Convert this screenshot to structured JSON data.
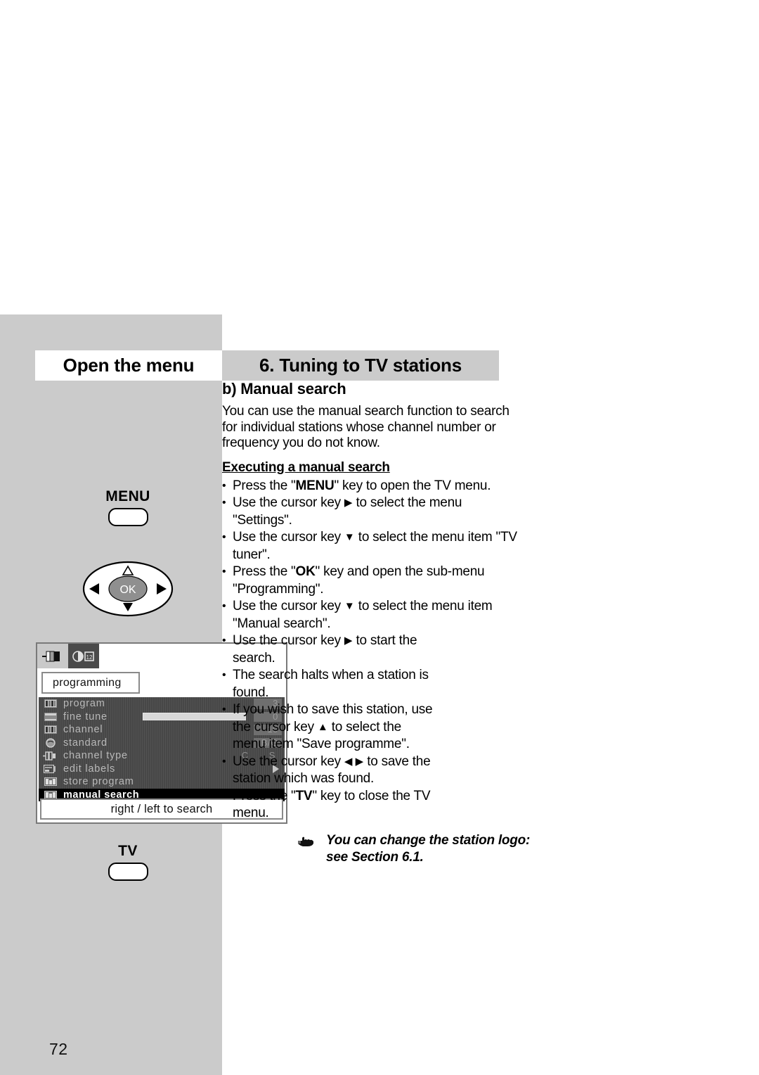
{
  "page": {
    "number": "72"
  },
  "header": {
    "left_title": "Open the menu",
    "right_title": "6. Tuning to TV stations"
  },
  "section": {
    "title": "b) Manual search",
    "intro": "You can use the manual search function to search for individual stations whose channel number or frequency you do not know.",
    "subtitle": "Executing a manual search",
    "steps": [
      {
        "pre": "Press the \"",
        "key": "MENU",
        "post": "\" key to open the TV menu."
      },
      {
        "pre": "Use the cursor key ",
        "arrow": "▶",
        "post": " to select the menu \"Settings\"."
      },
      {
        "pre": "Use the cursor key ",
        "arrow": "▼",
        "post": " to select the menu item \"TV tuner\"."
      },
      {
        "pre": "Press the \"",
        "key": "OK",
        "post": "\" key and open the sub-menu \"Programming\"."
      },
      {
        "pre": "Use the cursor key ",
        "arrow": "▼",
        "post": " to select the menu item \"Manual search\"."
      }
    ],
    "steps_indented": [
      {
        "pre": "Use the cursor key ",
        "arrow": "▶",
        "post": " to start the search."
      },
      {
        "pre": "The search halts when a station is found.",
        "arrow": "",
        "post": ""
      },
      {
        "pre": "If you wish to save this station, use the cursor key ",
        "arrow": "▲",
        "post": " to select the menu item \"Save programme\"."
      },
      {
        "pre": "Use the cursor key ",
        "arrow": "◀ ▶",
        "post": " to save the station which was found."
      },
      {
        "pre": "Press the \"",
        "key": "TV",
        "post": "\" key to close the TV menu."
      }
    ],
    "note": "You can change the station logo: see Section 6.1."
  },
  "keys": {
    "menu_label": "MENU",
    "tv_label": "TV",
    "ok_label": "OK"
  },
  "tv_menu": {
    "heading": "programming",
    "tabs": [
      {
        "icon": "contrast-slider-icon",
        "selected": true
      },
      {
        "icon": "tuner-channel-icon",
        "selected": false
      }
    ],
    "rows": [
      {
        "label": "program",
        "icon": "program-icon",
        "value": "3",
        "type": "value"
      },
      {
        "label": "fine tune",
        "icon": "fine-tune-icon",
        "value": "0",
        "type": "slider",
        "fill_percent": 50
      },
      {
        "label": "channel",
        "icon": "channel-icon",
        "value": "10",
        "type": "value"
      },
      {
        "label": "standard",
        "icon": "standard-icon",
        "value": "B/G",
        "type": "value"
      },
      {
        "label": "channel type",
        "icon": "channel-type-icon",
        "value": "S",
        "value2": "C",
        "type": "pair"
      },
      {
        "label": "edit labels",
        "icon": "edit-labels-icon",
        "value": "",
        "type": "arrow"
      },
      {
        "label": "store program",
        "icon": "store-program-icon",
        "value": "",
        "type": "none"
      },
      {
        "label": "manual search",
        "icon": "manual-search-icon",
        "value": "",
        "type": "none",
        "active": true
      }
    ],
    "footer": "right / left to search"
  },
  "colors": {
    "page_grey": "#cbcbcb",
    "menu_dark": "#4a4a4a",
    "highlight_black": "#000000"
  }
}
